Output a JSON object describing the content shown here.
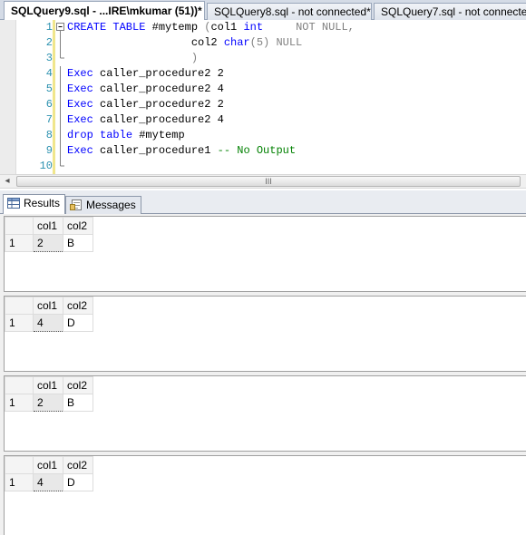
{
  "tabs": [
    {
      "label": "SQLQuery9.sql - ...IRE\\mkumar (51))*",
      "active": true
    },
    {
      "label": "SQLQuery8.sql - not connected*",
      "active": false
    },
    {
      "label": "SQLQuery7.sql - not connected",
      "active": false
    }
  ],
  "editor": {
    "line_numbers": [
      "1",
      "2",
      "3",
      "4",
      "5",
      "6",
      "7",
      "8",
      "9",
      "10"
    ],
    "lines": [
      [
        {
          "t": "CREATE TABLE",
          "c": "kw"
        },
        {
          "t": " #mytemp ",
          "c": "plain"
        },
        {
          "t": "(",
          "c": "gray"
        },
        {
          "t": "col1 ",
          "c": "plain"
        },
        {
          "t": "int",
          "c": "kw"
        },
        {
          "t": "     NOT NULL,",
          "c": "gray"
        }
      ],
      [
        {
          "t": "                   col2 ",
          "c": "plain"
        },
        {
          "t": "char",
          "c": "kw"
        },
        {
          "t": "(5) NULL",
          "c": "gray"
        }
      ],
      [
        {
          "t": "                   )",
          "c": "gray"
        }
      ],
      [
        {
          "t": "Exec",
          "c": "kw"
        },
        {
          "t": " caller_procedure2 2",
          "c": "plain"
        }
      ],
      [
        {
          "t": "Exec",
          "c": "kw"
        },
        {
          "t": " caller_procedure2 4",
          "c": "plain"
        }
      ],
      [
        {
          "t": "Exec",
          "c": "kw"
        },
        {
          "t": " caller_procedure2 2",
          "c": "plain"
        }
      ],
      [
        {
          "t": "Exec",
          "c": "kw"
        },
        {
          "t": " caller_procedure2 4",
          "c": "plain"
        }
      ],
      [
        {
          "t": "drop",
          "c": "kw"
        },
        {
          "t": " ",
          "c": "plain"
        },
        {
          "t": "table",
          "c": "kw"
        },
        {
          "t": " #mytemp",
          "c": "plain"
        }
      ],
      [
        {
          "t": "Exec",
          "c": "kw"
        },
        {
          "t": " caller_procedure1 ",
          "c": "plain"
        },
        {
          "t": "-- No Output",
          "c": "cm"
        }
      ],
      []
    ]
  },
  "scrollbar": {
    "left_arrow": "◂",
    "thumb_grip": "III"
  },
  "result_tabs": {
    "results_label": "Results",
    "messages_label": "Messages"
  },
  "result_sets": [
    {
      "columns": [
        "col1",
        "col2"
      ],
      "rows": [
        {
          "row_number": "1",
          "col1": "2",
          "col2": "B"
        }
      ]
    },
    {
      "columns": [
        "col1",
        "col2"
      ],
      "rows": [
        {
          "row_number": "1",
          "col1": "4",
          "col2": "D"
        }
      ]
    },
    {
      "columns": [
        "col1",
        "col2"
      ],
      "rows": [
        {
          "row_number": "1",
          "col1": "2",
          "col2": "B"
        }
      ]
    },
    {
      "columns": [
        "col1",
        "col2"
      ],
      "rows": [
        {
          "row_number": "1",
          "col1": "4",
          "col2": "D"
        }
      ]
    }
  ]
}
